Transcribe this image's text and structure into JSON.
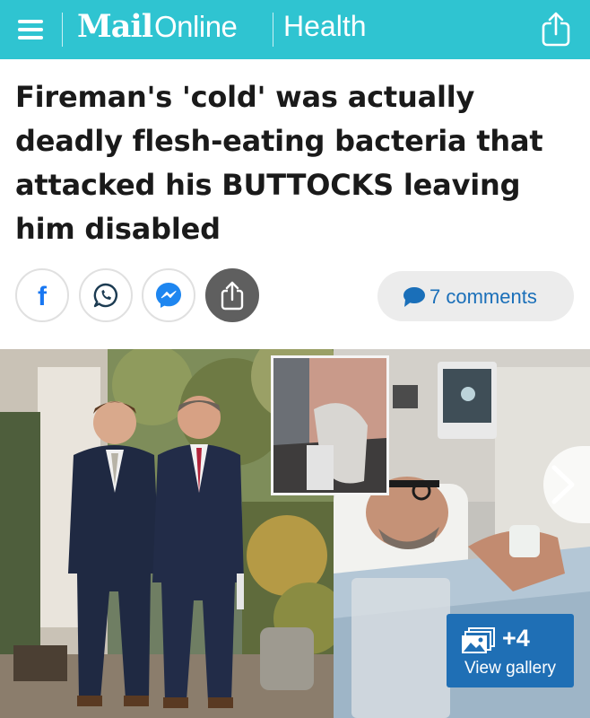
{
  "header": {
    "brand_mail": "Mail",
    "brand_online": "Online",
    "section": "Health"
  },
  "article": {
    "headline": "Fireman's 'cold' was actually deadly flesh-eating bacteria that attacked his BUTTOCKS leaving him disabled"
  },
  "share_buttons": [
    {
      "name": "facebook",
      "icon": "facebook-icon",
      "color": "#1877f2"
    },
    {
      "name": "whatsapp",
      "icon": "whatsapp-icon",
      "color": "#1c3b52"
    },
    {
      "name": "messenger",
      "icon": "messenger-icon",
      "color": "#1e86f0"
    },
    {
      "name": "share",
      "icon": "share-icon",
      "color": "#5f5f5f"
    }
  ],
  "comments": {
    "label": "7 comments",
    "icon": "speech-bubble-icon",
    "color": "#1a6fb9"
  },
  "gallery": {
    "count": "+4",
    "label": "View gallery",
    "icon": "gallery-icon",
    "color": "#1f6fb5"
  },
  "colors": {
    "header_bg": "#2fc4d1",
    "headline": "#1a1a1a"
  }
}
